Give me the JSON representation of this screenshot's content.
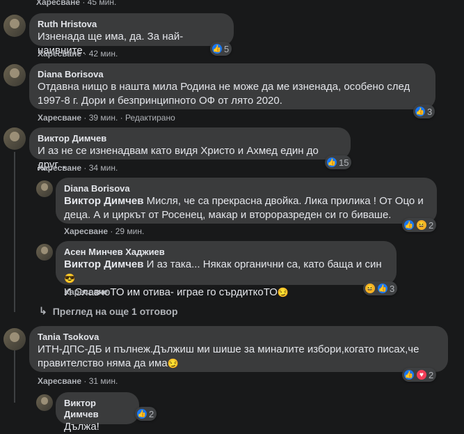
{
  "top_meta": {
    "like": "Харесване",
    "time": "45 мин."
  },
  "comments": [
    {
      "author": "Ruth Hristova",
      "text": "Изненада ще има, да. За най-наивните.",
      "like": "Харесване",
      "time": "42 мин.",
      "edited": "",
      "reactions": [
        "like-icon"
      ],
      "count": "5"
    },
    {
      "author": "Diana Borisova",
      "text": "Отдавна нищо в нашта мила Родина не може да ме изненада, особено след 1997-8 г. Дори и безпринципното ОФ от лято 2020.",
      "like": "Харесване",
      "time": "39 мин.",
      "edited": "Редактирано",
      "reactions": [
        "like-icon"
      ],
      "count": "3"
    },
    {
      "author": "Виктор Димчев",
      "text": "И аз не се изненадвам като видя Христо и Ахмед един до друг...",
      "like": "Харесване",
      "time": "34 мин.",
      "edited": "",
      "reactions": [
        "like-icon"
      ],
      "count": "15"
    }
  ],
  "replies": [
    {
      "author": "Diana Borisova",
      "mention": "Виктор Димчев",
      "text": "Мисля, че са прекрасна двойка. Лика прилика ! От Оцо и деца. А и циркът от Росенец, макар и второразреден си го биваше.",
      "like": "Харесване",
      "time": "29 мин.",
      "reactions": [
        "like-icon",
        "haha-icon"
      ],
      "count": "2"
    },
    {
      "author": "Асен Минчев Хаджиев",
      "mention": "Виктор Димчев",
      "text_line1": "И аз така... Някак органични са, като баща и син",
      "emoji1": "😎",
      "text_line2": "И СлавчоТО им отива- играе го сърдиткоТО",
      "emoji2": "😏",
      "like": "Харесване",
      "time": "",
      "reactions": [
        "haha-icon",
        "like-icon"
      ],
      "count": "3"
    }
  ],
  "more_replies": "Преглед на още 1 отговор",
  "tania": {
    "author": "Tania Tsokova",
    "text_line1": "ИТН-ДПС-ДБ и пълнеж.Дължиш ми шише за миналите избори,когато писах,че",
    "text_line2": "правителство няма да има",
    "emoji": "😏",
    "like": "Харесване",
    "time": "31 мин.",
    "reactions": [
      "like-icon",
      "love-icon"
    ],
    "count": "2"
  },
  "last_reply": {
    "author": "Виктор Димчев",
    "text": "Дължа!",
    "reactions": [
      "like-icon"
    ],
    "count": "2"
  }
}
